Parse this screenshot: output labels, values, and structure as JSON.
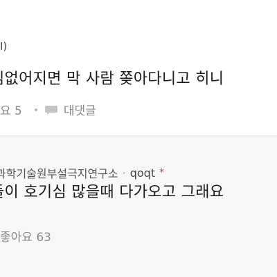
{
  "comment1": {
    "meta_fragment": "I)",
    "text": "심없어지면 막 사람 쫒아다니고 히니",
    "likes_fragment": "요 5",
    "reply_label": "대댓글"
  },
  "comment2": {
    "org_fragment": "과학기술원부설극지연구소",
    "author": "qoqt",
    "star": "*",
    "text": "들이 호기심 많을때 다가오고 그래요",
    "likes_fragment": "좋아요 63"
  },
  "icons": {
    "reply": "speech-bubble-icon"
  }
}
